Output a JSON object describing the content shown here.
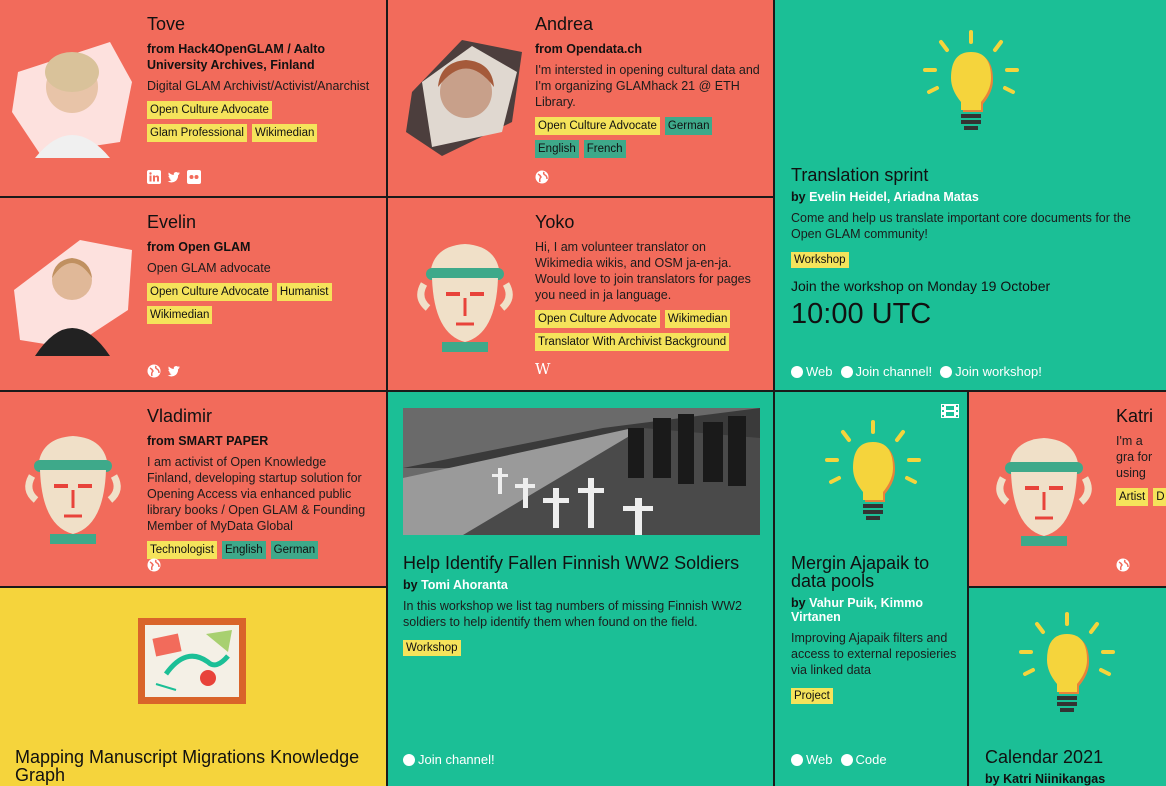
{
  "people": [
    {
      "name": "Tove",
      "from": "from Hack4OpenGLAM / Aalto University Archives, Finland",
      "desc": "Digital GLAM Archivist/Activist/Anarchist",
      "tags": [
        {
          "t": "Open Culture Advocate",
          "c": "y"
        },
        {
          "t": "Glam Professional",
          "c": "y"
        },
        {
          "t": "Wikimedian",
          "c": "y"
        }
      ],
      "socials": [
        "linkedin-icon",
        "twitter-icon",
        "flickr-icon"
      ]
    },
    {
      "name": "Andrea",
      "from": "from Opendata.ch",
      "desc": "I'm intersted in opening cultural data and I'm organizing GLAMhack 21 @ ETH Library.",
      "tags": [
        {
          "t": "Open Culture Advocate",
          "c": "y"
        },
        {
          "t": "German",
          "c": "g"
        },
        {
          "t": "English",
          "c": "g"
        },
        {
          "t": "French",
          "c": "g"
        }
      ],
      "socials": [
        "globe-icon"
      ]
    },
    {
      "name": "Evelin",
      "from": "from Open GLAM",
      "desc": "Open GLAM advocate",
      "tags": [
        {
          "t": "Open Culture Advocate",
          "c": "y"
        },
        {
          "t": "Humanist",
          "c": "y"
        },
        {
          "t": "Wikimedian",
          "c": "y"
        }
      ],
      "socials": [
        "globe-icon",
        "twitter-icon"
      ]
    },
    {
      "name": "Yoko",
      "from": "",
      "desc": "Hi, I am volunteer translator on Wikimedia wikis, and OSM ja-en-ja. Would love to join translators for pages you need in ja language.",
      "tags": [
        {
          "t": "Open Culture Advocate",
          "c": "y"
        },
        {
          "t": "Wikimedian",
          "c": "y"
        },
        {
          "t": "Translator With Archivist Background",
          "c": "y"
        }
      ],
      "socials": [
        "wikipedia-icon"
      ]
    },
    {
      "name": "Vladimir",
      "from": "from SMART PAPER",
      "desc": "I am activist of Open Knowledge Finland, developing startup solution for Opening Access via enhanced public library books / Open GLAM & Founding Member of MyData Global",
      "tags": [
        {
          "t": "Technologist",
          "c": "y"
        },
        {
          "t": "English",
          "c": "g"
        },
        {
          "t": "German",
          "c": "g"
        }
      ],
      "socials": [
        "globe-icon"
      ]
    },
    {
      "name": "Katri",
      "from": "",
      "desc": "I'm a gra for using",
      "tags": [
        {
          "t": "Artist",
          "c": "y"
        },
        {
          "t": "D",
          "c": "y"
        }
      ],
      "socials": [
        "globe-icon"
      ]
    }
  ],
  "translation": {
    "title": "Translation sprint",
    "by": "by",
    "authors": "Evelin Heidel, Ariadna Matas",
    "desc": "Come and help us translate important core documents for the Open GLAM community!",
    "tag": "Workshop",
    "when": "Join the workshop on Monday 19 October",
    "time": "10:00 UTC",
    "links": [
      "Web",
      "Join channel!",
      "Join workshop!"
    ]
  },
  "fallen": {
    "title": "Help Identify Fallen Finnish WW2 Soldiers",
    "by": "by",
    "authors": "Tomi Ahoranta",
    "desc": "In this workshop we list tag numbers of missing Finnish WW2 soldiers to help identify them when found on the field.",
    "tag": "Workshop",
    "link": "Join channel!"
  },
  "mergin": {
    "title": "Mergin Ajapaik to data pools",
    "by": "by",
    "authors": "Vahur Puik, Kimmo Virtanen",
    "desc": "Improving Ajapaik filters and access to external reposieries via linked data",
    "tag": "Project",
    "links": [
      "Web",
      "Code"
    ]
  },
  "mapping": {
    "title": "Mapping Manuscript Migrations Knowledge Graph"
  },
  "calendar": {
    "title": "Calendar 2021",
    "by": "by",
    "authors": "Katri Niinikangas"
  },
  "colors": {
    "red": "#f26b5b",
    "green": "#1bbf96",
    "yellow": "#f5d43c"
  }
}
